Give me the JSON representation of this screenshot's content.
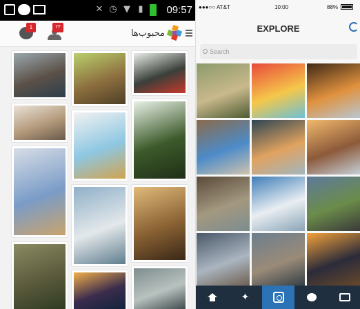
{
  "android": {
    "status": {
      "time": "09:57"
    },
    "header": {
      "title": "محبوب‌ها",
      "chat_badge": "1",
      "user_badge": "۲۳"
    },
    "icons": [
      "chat-icon",
      "user-icon",
      "hamburger-menu-icon",
      "app-logo-icon"
    ],
    "tiles": [
      {
        "name": "lake-cliff-photo",
        "colors": [
          "#9aa7ad",
          "#5b5148",
          "#2c3e4d"
        ]
      },
      {
        "name": "kitchen-interior-photo",
        "colors": [
          "#e9e2d8",
          "#b49a7c",
          "#6a5a4a"
        ]
      },
      {
        "name": "bird-on-flowers-photo",
        "colors": [
          "#d7dde7",
          "#7a9cc7",
          "#c9a36d"
        ]
      },
      {
        "name": "elephant-photo",
        "colors": [
          "#8a8a62",
          "#5b5a3c",
          "#2f3b23"
        ]
      },
      {
        "name": "monkey-camera-photo",
        "colors": [
          "#b9cf6c",
          "#8d6f3f",
          "#4e3f26"
        ]
      },
      {
        "name": "cartoon-stairs-illustration",
        "colors": [
          "#f2f2f2",
          "#8ec7e2",
          "#d1a34f"
        ]
      },
      {
        "name": "terraced-pools-photo",
        "colors": [
          "#8fb0c8",
          "#e3e8ea",
          "#5f7d8e"
        ]
      },
      {
        "name": "sunset-sea-photo",
        "colors": [
          "#f1b04b",
          "#3b2c4d",
          "#10233b"
        ]
      },
      {
        "name": "insect-photo",
        "colors": [
          "#e9eee9",
          "#3a3f3a",
          "#c63a2a"
        ]
      },
      {
        "name": "flower-spill-photo",
        "colors": [
          "#e8f0e6",
          "#3c5a2a",
          "#1f2e18"
        ]
      },
      {
        "name": "dogs-basket-photo",
        "colors": [
          "#e1ba7b",
          "#8a6234",
          "#3a2816"
        ]
      },
      {
        "name": "animal-closeup-photo",
        "colors": [
          "#7d8d8e",
          "#b9c2bf",
          "#3d4a4b"
        ]
      }
    ]
  },
  "ios": {
    "status": {
      "carrier": "●●●○○ AT&T",
      "time": "10:00",
      "battery": "88%"
    },
    "title": "EXPLORE",
    "search_placeholder": "Search",
    "icons": [
      "refresh-icon",
      "search-icon"
    ],
    "photos": [
      {
        "name": "person-in-field-photo",
        "colors": [
          "#8c9a6b",
          "#c9b98c",
          "#4d5b33"
        ]
      },
      {
        "name": "hot-air-balloon-photo",
        "colors": [
          "#e84a3a",
          "#f5c74a",
          "#6bc0d6"
        ]
      },
      {
        "name": "coast-sunset-photo",
        "colors": [
          "#3f2a18",
          "#e0913d",
          "#b9c6d1"
        ]
      },
      {
        "name": "blue-tent-photo",
        "colors": [
          "#8a6a4a",
          "#4d8bc9",
          "#cfc3ad"
        ]
      },
      {
        "name": "ocean-horizon-photo",
        "colors": [
          "#2e4553",
          "#e0a25f",
          "#a3b6bf"
        ]
      },
      {
        "name": "rock-sunset-photo",
        "colors": [
          "#f2b86b",
          "#8c5a3a",
          "#c4cfd8"
        ]
      },
      {
        "name": "city-building-photo",
        "colors": [
          "#5a4a3a",
          "#a39880",
          "#7c8d8f"
        ]
      },
      {
        "name": "snow-mountain-photo",
        "colors": [
          "#3f7eb8",
          "#e9eef2",
          "#8aa4b7"
        ]
      },
      {
        "name": "mountain-road-photo",
        "colors": [
          "#5d7a9c",
          "#6b8c4a",
          "#3a3a3a"
        ]
      },
      {
        "name": "city-skyline-photo",
        "colors": [
          "#4a5868",
          "#aab5c0",
          "#6a5a4a"
        ]
      },
      {
        "name": "dome-rock-photo",
        "colors": [
          "#6c7e8e",
          "#9a8b78",
          "#2e3a44"
        ]
      },
      {
        "name": "seaside-lights-photo",
        "colors": [
          "#f3a13a",
          "#2b2b3a",
          "#6a4a2a"
        ]
      }
    ],
    "tabs": [
      {
        "name": "home-tab-icon"
      },
      {
        "name": "explore-tab-icon"
      },
      {
        "name": "camera-tab-icon"
      },
      {
        "name": "news-tab-icon"
      },
      {
        "name": "profile-tab-icon"
      }
    ],
    "active_tab_color": "#2c73b5",
    "accent": "#2d6fb0"
  }
}
